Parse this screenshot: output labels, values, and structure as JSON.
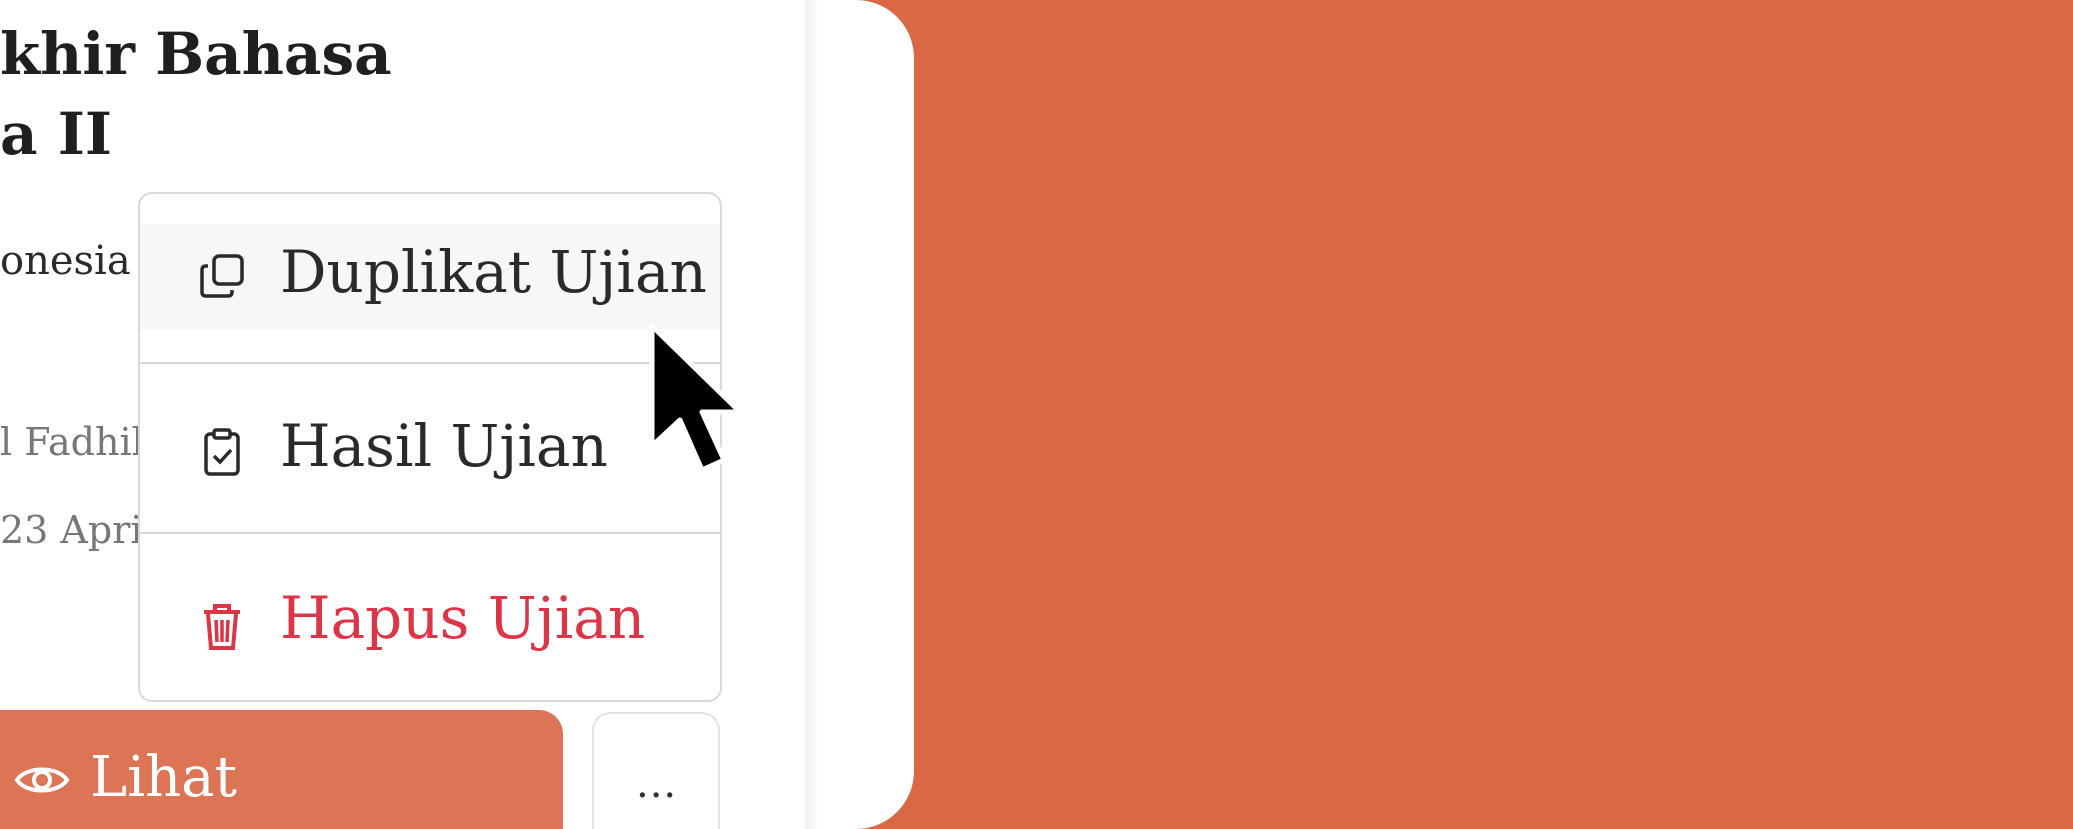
{
  "exam_card": {
    "title_line1": "khir Bahasa",
    "title_line2": "a II",
    "subject": "onesia",
    "author": "l Fadhil",
    "date": "23 Apri",
    "view_button_label": "Lihat",
    "more_button_label": "..."
  },
  "dropdown_menu": {
    "items": [
      {
        "label": "Duplikat Ujian",
        "icon": "duplicate-icon"
      },
      {
        "label": "Hasil Ujian",
        "icon": "clipboard-check-icon"
      },
      {
        "label": "Hapus Ujian",
        "icon": "trash-icon"
      }
    ]
  },
  "colors": {
    "brand_background": "#da6845",
    "view_button": "#db7556",
    "danger": "#dc3545"
  }
}
